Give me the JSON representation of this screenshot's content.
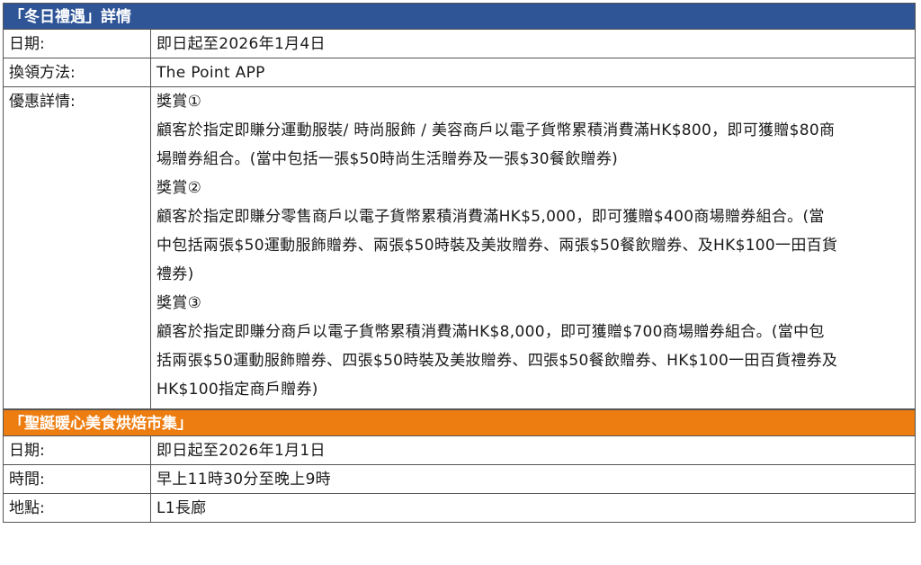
{
  "winter": {
    "title": "「冬日禮遇」詳情",
    "date_label": "日期:",
    "date_value": "即日起至2026年1月4日",
    "method_label": "換領方法:",
    "method_value": "The Point APP",
    "details_label": "優惠詳情:",
    "rewards": [
      {
        "heading": "獎賞①",
        "lines": [
          "顧客於指定即賺分運動服裝/ 時尚服飾 / 美容商戶以電子貨幣累積消費滿HK$800，即可獲贈$80商",
          "場贈券組合。(當中包括一張$50時尚生活贈券及一張$30餐飲贈券)"
        ]
      },
      {
        "heading": "獎賞②",
        "lines": [
          "顧客於指定即賺分零售商戶以電子貨幣累積消費滿HK$5,000，即可獲贈$400商場贈券組合。(當",
          "中包括兩張$50運動服飾贈券、兩張$50時裝及美妝贈券、兩張$50餐飲贈券、及HK$100一田百貨",
          "禮券)"
        ]
      },
      {
        "heading": "獎賞③",
        "lines": [
          "顧客於指定即賺分商戶以電子貨幣累積消費滿HK$8,000，即可獲贈$700商場贈券組合。(當中包",
          "括兩張$50運動服飾贈券、四張$50時裝及美妝贈券、四張$50餐飲贈券、HK$100一田百貨禮券及",
          "HK$100指定商戶贈券)"
        ]
      }
    ]
  },
  "market": {
    "title": "「聖誕暖心美食烘焙市集」",
    "date_label": "日期:",
    "date_value": "即日起至2026年1月1日",
    "time_label": "時間:",
    "time_value": "早上11時30分至晚上9時",
    "place_label": "地點:",
    "place_value": "L1長廊"
  },
  "colors": {
    "header_blue": "#2f5597",
    "header_orange": "#ee7d11"
  }
}
